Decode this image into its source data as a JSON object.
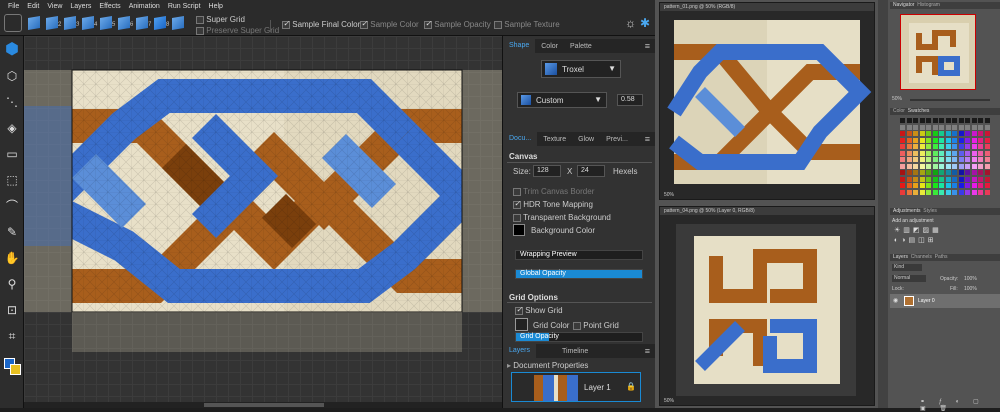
{
  "menu": [
    "File",
    "Edit",
    "View",
    "Layers",
    "Effects",
    "Animation",
    "Run Script",
    "Help"
  ],
  "toolbar": {
    "cube_numbers": [
      "2",
      "3",
      "4",
      "5",
      "6",
      "7",
      "8"
    ],
    "super_grid": "Super Grid",
    "preserve_super_grid": "Preserve Super Grid",
    "sample_final_color": "Sample Final Color",
    "sample_color": "Sample Color",
    "sample_opacity": "Sample Opacity",
    "sample_texture": "Sample Texture"
  },
  "panel": {
    "tabs1": [
      "Shape",
      "Color",
      "Palette"
    ],
    "brush": "Troxel",
    "custom": "Custom",
    "custom_value": "0.58",
    "tabs2": [
      "Docu...",
      "Texture",
      "Glow",
      "Previ..."
    ],
    "canvas_header": "Canvas",
    "size_label": "Size:",
    "width": "128",
    "x_label": "X",
    "height": "24",
    "units": "Hexels",
    "trim": "Trim Canvas Border",
    "hdr": "HDR Tone Mapping",
    "transparent": "Transparent Background",
    "background": "Background Color",
    "wrapping": "Wrapping Preview",
    "global_opacity": "Global Opacity",
    "global_opacity_value": 1.0,
    "grid_header": "Grid Options",
    "show_grid": "Show Grid",
    "grid_color": "Grid Color",
    "point_grid": "Point Grid",
    "grid_opacity": "Grid Opacity",
    "grid_opacity_value": 0.26,
    "tabs3": [
      "Layers",
      "Timeline"
    ],
    "document_properties": "Document Properties",
    "layer1": "Layer 1"
  },
  "ps": {
    "doc1_title": "pattern_01.png @ 50% (RGB/8)",
    "doc2_title": "pattern_04.png @ 50% (Layer 0, RGB/8)",
    "doc1_status": "50%",
    "doc2_status": "50%",
    "navigator_tabs": [
      "Navigator",
      "Histogram"
    ],
    "nav_zoom": "50%",
    "color_tabs": [
      "Color",
      "Swatches"
    ],
    "adjust_tabs": [
      "Adjustments",
      "Styles"
    ],
    "add_adjustment": "Add an adjustment",
    "layers_tabs": [
      "Layers",
      "Channels",
      "Paths"
    ],
    "kind": "Kind",
    "blend": "Normal",
    "opacity_label": "Opacity:",
    "opacity_value": "100%",
    "lock_label": "Lock:",
    "fill_label": "Fill:",
    "fill_value": "100%",
    "layer_name": "Layer 0"
  },
  "colors": {
    "blue": "#3a6ecb",
    "blue_light": "#5b8ed8",
    "brown": "#a85e1c",
    "brown_dark": "#7a3f0c",
    "cream": "#e8e0c8",
    "accent": "#1a8ad4"
  }
}
